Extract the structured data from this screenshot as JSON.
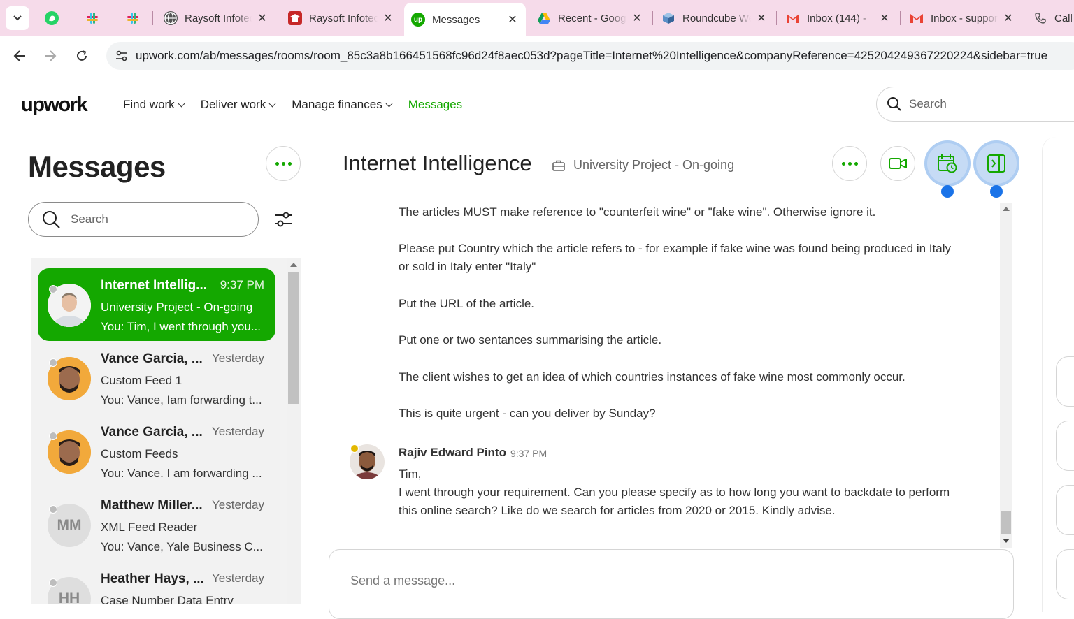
{
  "browser": {
    "tabs": [
      {
        "title": "Raysoft Infotech",
        "favicon": "globe-icon"
      },
      {
        "title": "Raysoft Infotech",
        "favicon": "scholar-icon"
      },
      {
        "title": "Messages",
        "favicon": "upwork-icon",
        "active": true
      },
      {
        "title": "Recent - Google Drive",
        "favicon": "google-drive-icon"
      },
      {
        "title": "Roundcube Webmail",
        "favicon": "roundcube-icon"
      },
      {
        "title": "Inbox (144) -",
        "favicon": "gmail-icon"
      },
      {
        "title": "Inbox - support",
        "favicon": "gmail-icon"
      },
      {
        "title": "Call",
        "favicon": "phone-icon"
      }
    ],
    "url": "upwork.com/ab/messages/rooms/room_85c3a8b166451568fc96d24f8aec053d?pageTitle=Internet%20Intelligence&companyReference=425204249367220224&sidebar=true"
  },
  "header": {
    "logo": "upwork",
    "nav": [
      {
        "label": "Find work"
      },
      {
        "label": "Deliver work"
      },
      {
        "label": "Manage finances"
      },
      {
        "label": "Messages"
      }
    ],
    "search_placeholder": "Search"
  },
  "sidebar": {
    "title": "Messages",
    "search_placeholder": "Search",
    "rooms": [
      {
        "name": "Internet Intellig...",
        "time": "9:37 PM",
        "project": "University Project - On-going",
        "last": "You: Tim, I went through you...",
        "active": true
      },
      {
        "name": "Vance Garcia, ...",
        "time": "Yesterday",
        "project": "Custom Feed 1",
        "last": "You: Vance, Iam forwarding t..."
      },
      {
        "name": "Vance Garcia, ...",
        "time": "Yesterday",
        "project": "Custom Feeds",
        "last": "You: Vance. I am forwarding ..."
      },
      {
        "name": "Matthew Miller...",
        "time": "Yesterday",
        "project": "XML Feed Reader",
        "last": "You: Vance, Yale Business C...",
        "initials": "MM"
      },
      {
        "name": "Heather Hays, ...",
        "time": "Yesterday",
        "project": "Case Number Data Entry",
        "last": "",
        "initials": "HH"
      }
    ]
  },
  "conversation": {
    "title": "Internet Intelligence",
    "subtitle": "University Project - On-going",
    "paragraphs": [
      "The articles MUST make reference to \"counterfeit wine\" or \"fake wine\". Otherwise ignore it.",
      "Please put Country which the article refers to - for example if fake wine was found being produced in Italy or sold in Italy enter \"Italy\"",
      "Put the URL of the article.",
      "Put one or two sentances summarising the article.",
      "The client wishes to get an idea of which countries instances of fake wine most commonly occur.",
      "This is quite urgent - can you deliver by Sunday?"
    ],
    "reply": {
      "sender": "Rajiv Edward Pinto",
      "time": "9:37 PM",
      "lines": [
        "Tim,",
        "I went through your requirement. Can you please specify as to how long you want to backdate to perform this online search? Like do we search for articles from 2020 or 2015. Kindly advise."
      ]
    },
    "composer_placeholder": "Send a message..."
  },
  "colors": {
    "brand_green": "#14a800",
    "tabbar": "#f6dbea",
    "highlight_blue": "#1a73e8"
  }
}
